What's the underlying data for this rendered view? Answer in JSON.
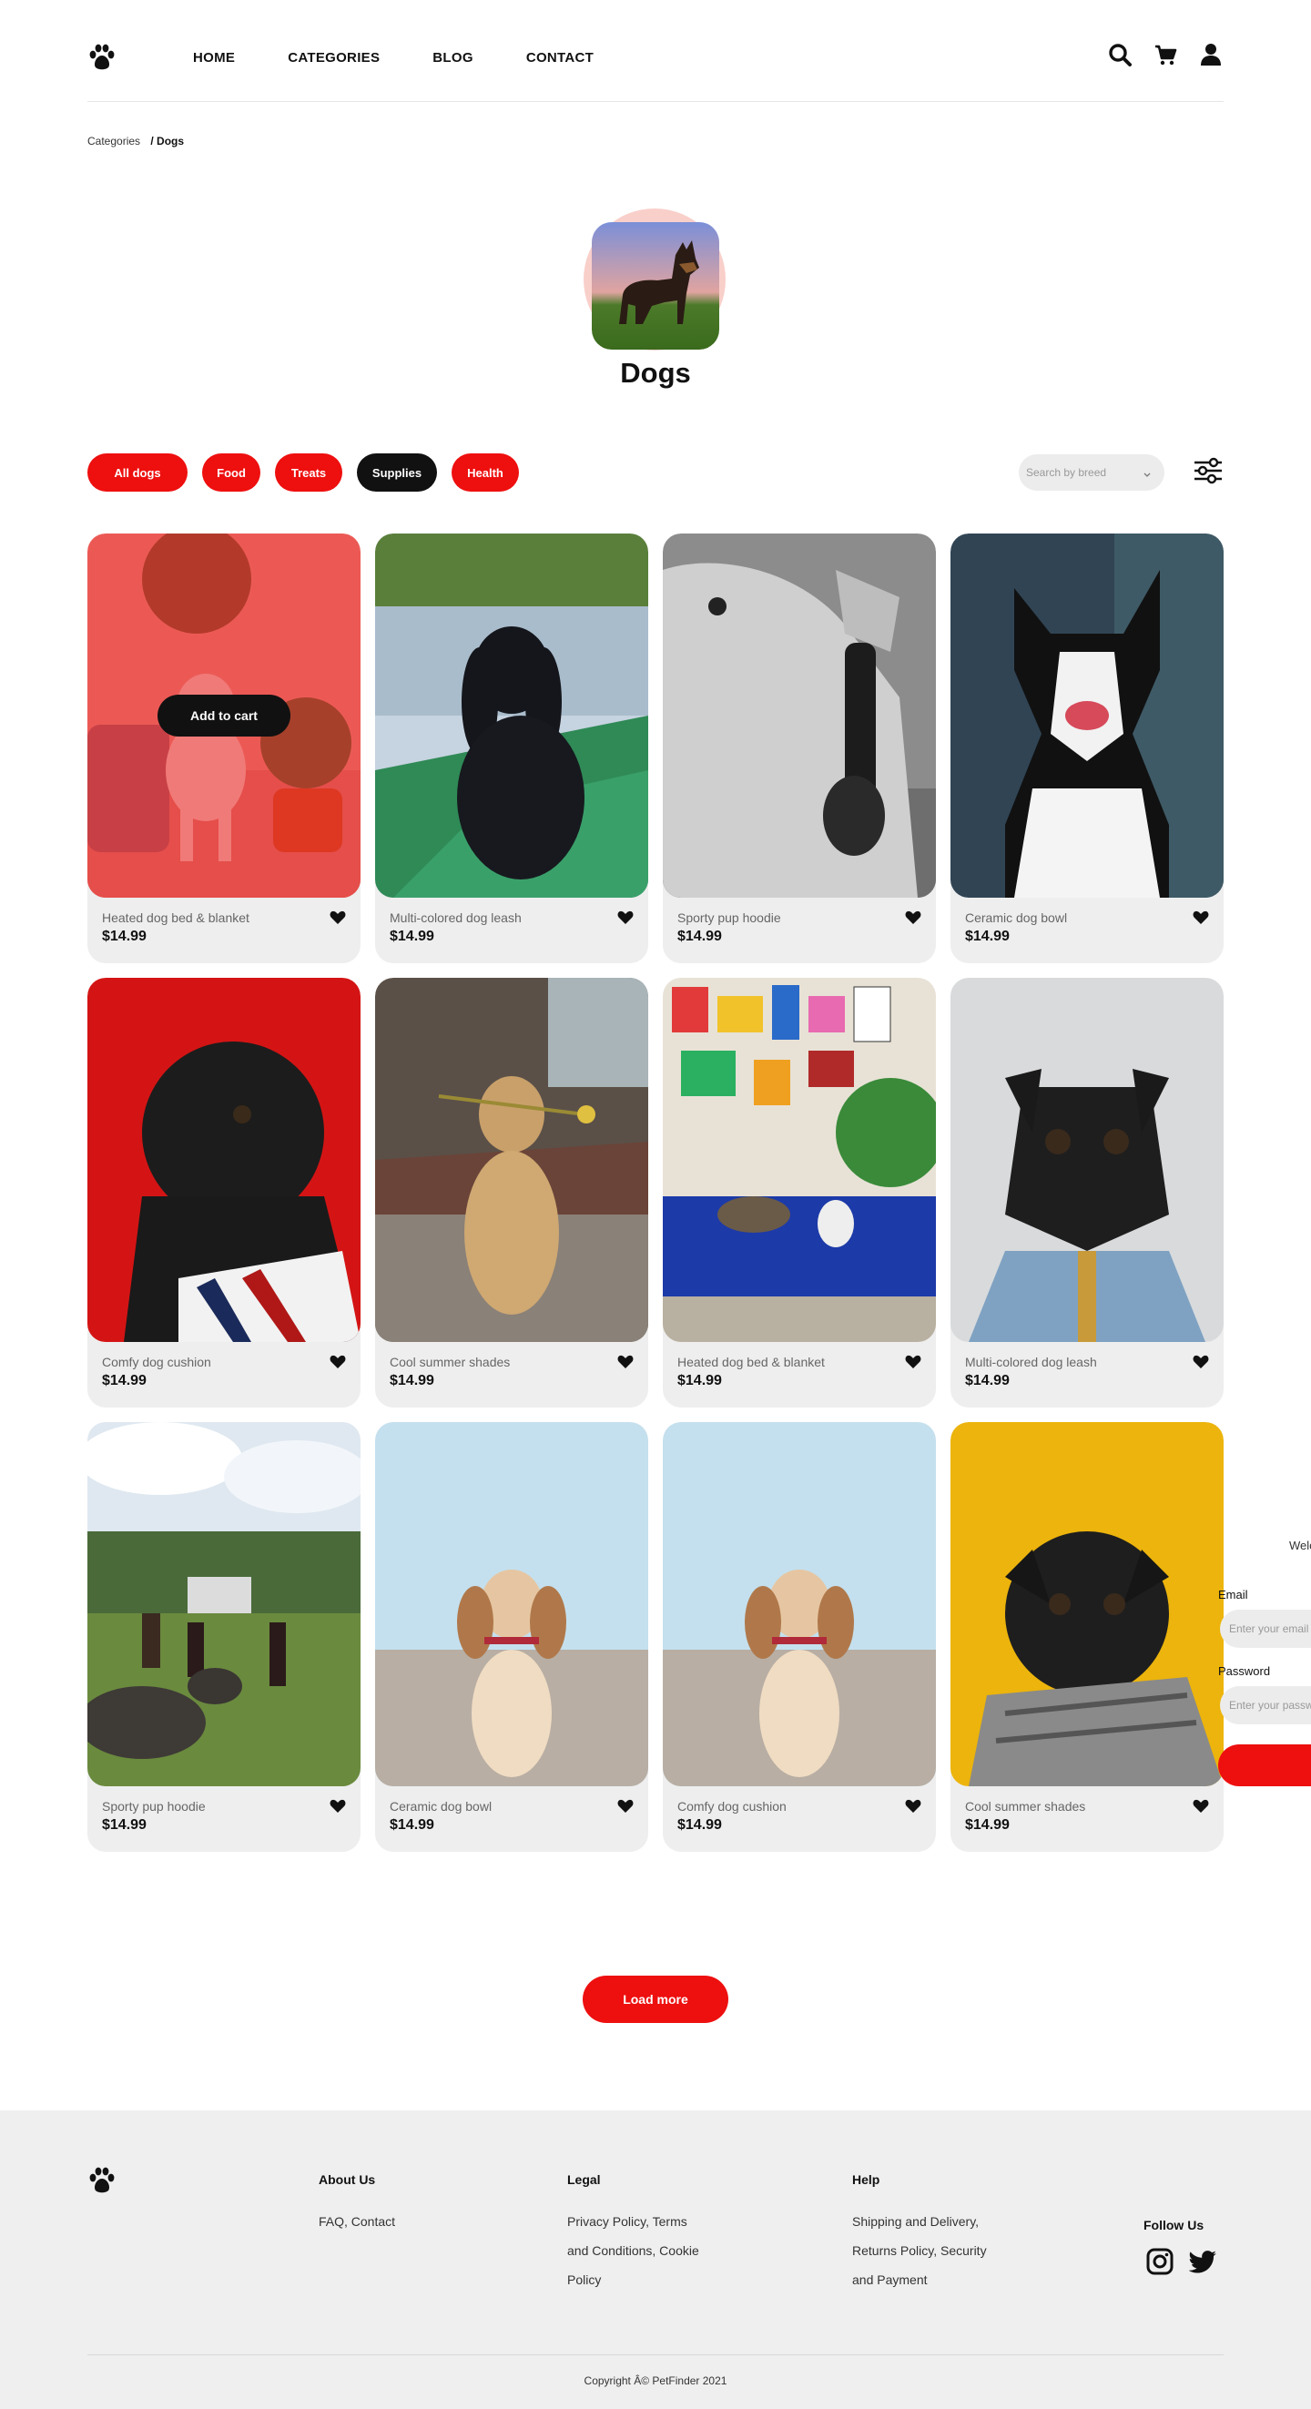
{
  "header": {
    "nav": [
      "HOME",
      "CATEGORIES",
      "BLOG",
      "CONTACT"
    ],
    "icons": [
      "paw-logo-icon",
      "search-icon",
      "cart-icon",
      "user-icon"
    ]
  },
  "breadcrumb": {
    "parent": "Categories",
    "current": "/ Dogs"
  },
  "category": {
    "title": "Dogs"
  },
  "filters": {
    "chips": [
      {
        "label": "All dogs",
        "style": "red"
      },
      {
        "label": "Food",
        "style": "red"
      },
      {
        "label": "Treats",
        "style": "red"
      },
      {
        "label": "Supplies",
        "style": "dark"
      },
      {
        "label": "Health",
        "style": "red"
      }
    ],
    "search_placeholder": "Search by breed"
  },
  "hover_card": {
    "add_to_cart_label": "Add to cart"
  },
  "products": [
    {
      "name": "Heated dog bed & blanket",
      "price": "$14.99"
    },
    {
      "name": "Multi-colored dog leash",
      "price": "$14.99"
    },
    {
      "name": "Sporty pup hoodie",
      "price": "$14.99"
    },
    {
      "name": "Ceramic dog bowl",
      "price": "$14.99"
    },
    {
      "name": "Comfy dog cushion",
      "price": "$14.99"
    },
    {
      "name": "Cool summer shades",
      "price": "$14.99"
    },
    {
      "name": "Heated dog bed & blanket",
      "price": "$14.99"
    },
    {
      "name": "Multi-colored dog leash",
      "price": "$14.99"
    },
    {
      "name": "Sporty pup hoodie",
      "price": "$14.99"
    },
    {
      "name": "Ceramic dog bowl",
      "price": "$14.99"
    },
    {
      "name": "Comfy dog cushion",
      "price": "$14.99"
    },
    {
      "name": "Cool summer shades",
      "price": "$14.99"
    }
  ],
  "login": {
    "welcome": "Welc",
    "email_label": "Email",
    "email_placeholder": "Enter your email",
    "password_label": "Password",
    "password_placeholder": "Enter your password"
  },
  "load_more": "Load more",
  "footer": {
    "about": {
      "title": "About Us",
      "text": "FAQ, Contact"
    },
    "legal": {
      "title": "Legal",
      "lines": [
        "Privacy Policy, Terms",
        "and Conditions, Cookie",
        "Policy"
      ]
    },
    "help": {
      "title": "Help",
      "lines": [
        "Shipping and Delivery,",
        "Returns Policy, Security",
        "and Payment"
      ]
    },
    "follow": "Follow Us",
    "copyright": "Copyright Â© PetFinder 2021"
  },
  "colors": {
    "accent": "#ee0f0f",
    "dark": "#111111",
    "card_bg": "#eeeeee",
    "footer_bg": "#efefef"
  }
}
